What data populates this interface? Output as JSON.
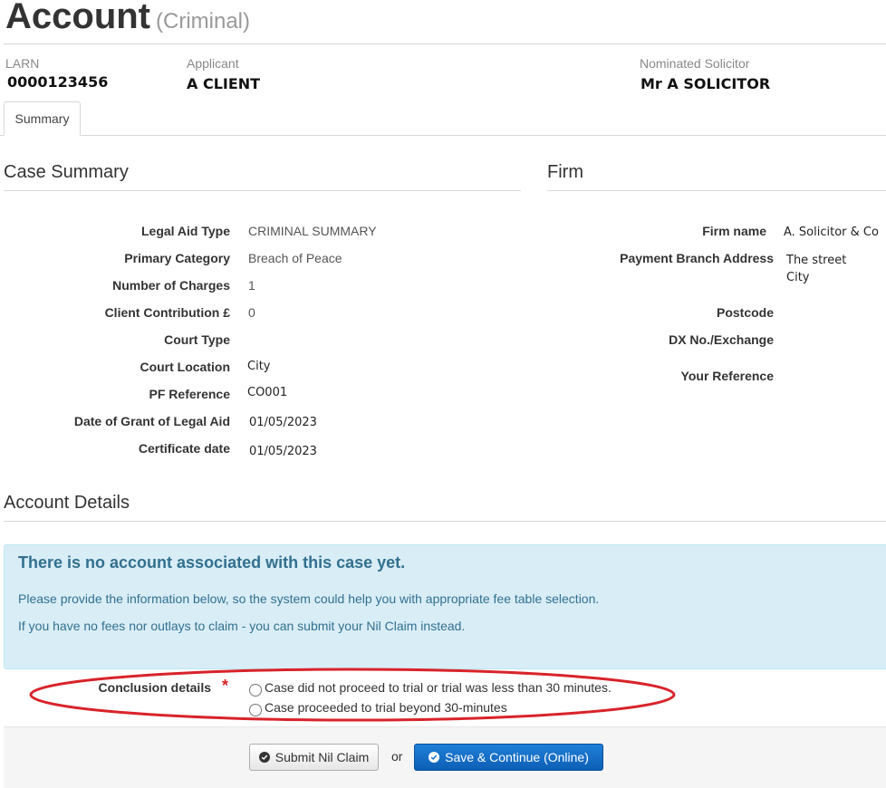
{
  "header": {
    "title": "Account",
    "subtitle": "(Criminal)"
  },
  "case_info": {
    "larn_label": "LARN",
    "larn_value": "0000123456",
    "applicant_label": "Applicant",
    "applicant_value": "A CLIENT",
    "solicitor_label": "Nominated Solicitor",
    "solicitor_value": "Mr A SOLICITOR"
  },
  "tabs": [
    {
      "label": "Summary"
    }
  ],
  "case_summary": {
    "heading": "Case Summary",
    "rows": [
      {
        "label": "Legal Aid Type",
        "value": "CRIMINAL SUMMARY"
      },
      {
        "label": "Primary Category",
        "value": "Breach of Peace"
      },
      {
        "label": "Number of Charges",
        "value": "1"
      },
      {
        "label": "Client Contribution £",
        "value": "0"
      },
      {
        "label": "Court Type",
        "value": ""
      },
      {
        "label": "Court Location",
        "value": "City"
      },
      {
        "label": "PF Reference",
        "value": "CO001"
      },
      {
        "label": "Date of Grant of Legal Aid",
        "value": "01/05/2023"
      },
      {
        "label": "Certificate date",
        "value": "01/05/2023"
      }
    ]
  },
  "firm": {
    "heading": "Firm",
    "firm_name_label": "Firm name",
    "firm_name_value": "A. Solicitor & Co",
    "address_label": "Payment Branch Address",
    "address_line1": "The street",
    "address_line2": "City",
    "postcode_label": "Postcode",
    "postcode_value": "",
    "dx_label": "DX No./Exchange",
    "dx_value": "",
    "reference_label": "Your Reference",
    "reference_value": ""
  },
  "account_details": {
    "heading": "Account Details",
    "info_title": "There is no account associated with this case yet.",
    "info_line1": "Please provide the information below, so the system could help you with appropriate fee table selection.",
    "info_line2": "If you have no fees nor outlays to claim - you can submit your Nil Claim instead.",
    "conclusion_label": "Conclusion details",
    "required_marker": "*",
    "options": [
      "Case did not proceed to trial or trial was less than 30 minutes.",
      "Case proceeded to trial beyond 30-minutes"
    ]
  },
  "actions": {
    "nil_claim_label": "Submit Nil Claim",
    "or_text": "or",
    "save_label": "Save & Continue (Online)"
  },
  "colors": {
    "info_bg": "#d9edf7",
    "info_text": "#31708f",
    "primary": "#1670cc",
    "annotation": "#d9232a",
    "required": "#d9232a"
  }
}
